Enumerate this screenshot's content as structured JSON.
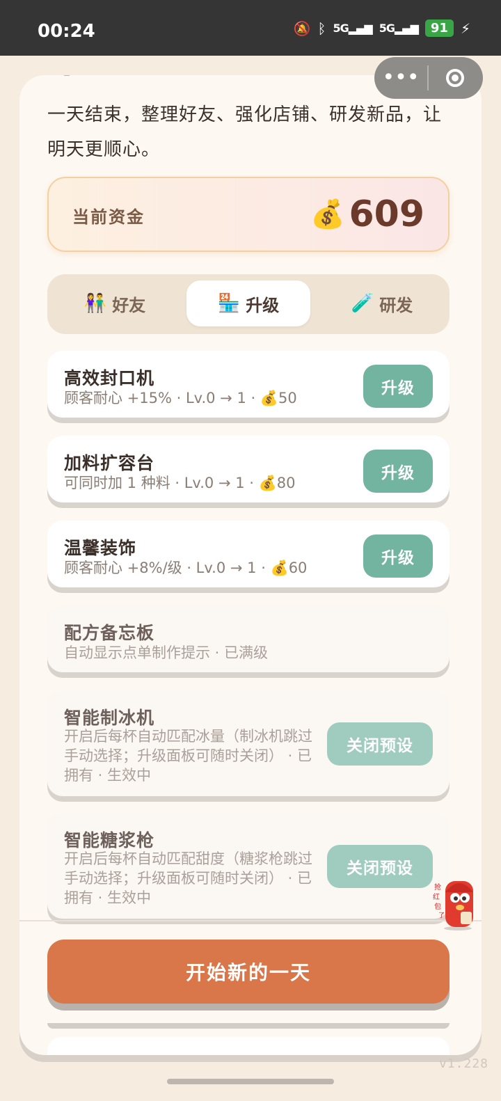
{
  "status": {
    "time": "00:24",
    "battery": "91",
    "net1": "5G",
    "net2": "5G"
  },
  "intro": "一天结束，整理好友、强化店铺、研发新品，让明天更顺心。",
  "funds": {
    "label": "当前资金",
    "amount": "609"
  },
  "tabs": [
    {
      "label": "好友",
      "icon": "👫",
      "active": false
    },
    {
      "label": "升级",
      "icon": "🏪",
      "active": true
    },
    {
      "label": "研发",
      "icon": "🧪",
      "active": false
    }
  ],
  "upgrades": [
    {
      "title": "高效封口机",
      "desc": "顾客耐心 +15% · Lv.0 → 1 · 💰50",
      "button": "升级"
    },
    {
      "title": "加料扩容台",
      "desc": "可同时加 1 种料 · Lv.0 → 1 · 💰80",
      "button": "升级"
    },
    {
      "title": "温馨装饰",
      "desc": "顾客耐心 +8%/级 · Lv.0 → 1 · 💰60",
      "button": "升级"
    },
    {
      "title": "配方备忘板",
      "desc": "自动显示点单制作提示 · 已满级"
    },
    {
      "title": "智能制冰机",
      "desc": "开启后每杯自动匹配冰量（制冰机跳过手动选择；升级面板可随时关闭） · 已拥有 · 生效中",
      "button": "关闭预设"
    },
    {
      "title": "智能糖浆枪",
      "desc": "开启后每杯自动匹配甜度（糖浆枪跳过手动选择；升级面板可随时关闭） · 已拥有 · 生效中",
      "button": "关闭预设"
    }
  ],
  "start_button": "开始新的一天",
  "mascot_text": "抢红包了",
  "version": "v1.228"
}
